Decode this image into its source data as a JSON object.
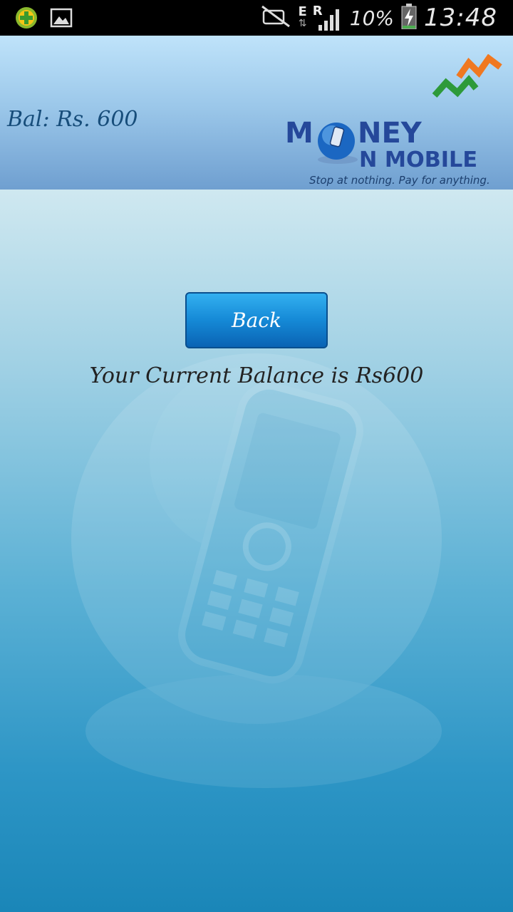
{
  "statusbar": {
    "network_e": "E",
    "network_r": "R",
    "battery_percent": "10%",
    "time": "13:48",
    "icons": [
      "app-plus-icon",
      "image-icon",
      "mute-icon",
      "data-arrows-icon",
      "signal-icon",
      "battery-charging-icon"
    ]
  },
  "header": {
    "balance_label": "Bal: Rs. 600",
    "logo": {
      "word1": "M",
      "word1_rest": "NEY",
      "word2": "N MOBILE",
      "tagline": "Stop at nothing. Pay for anything."
    }
  },
  "main": {
    "back_label": "Back",
    "balance_message": "Your Current Balance is Rs600"
  },
  "colors": {
    "header_top": "#bfe3fa",
    "button": "#1589d6",
    "brand_blue": "#25489a",
    "brand_orange": "#f07820",
    "brand_green": "#2e9a3a"
  }
}
